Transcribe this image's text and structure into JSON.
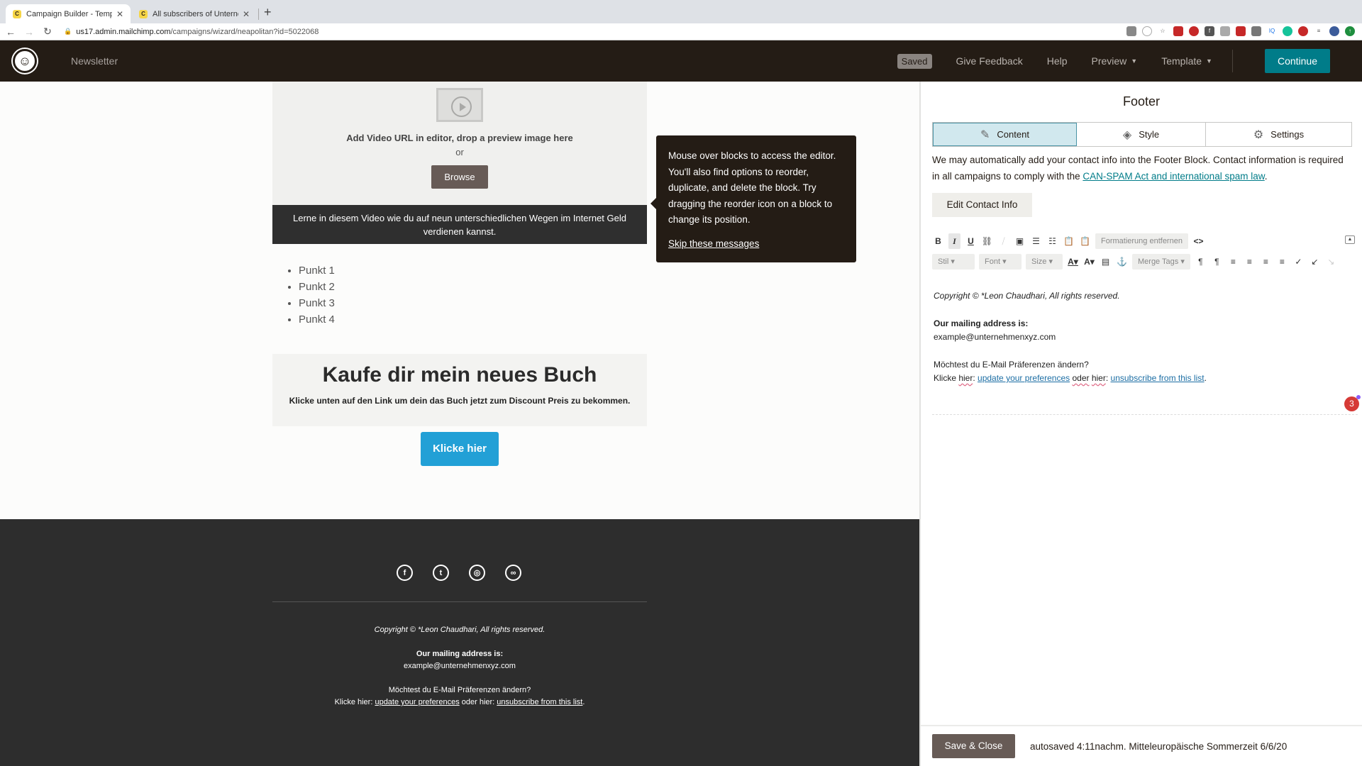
{
  "browser": {
    "tabs": [
      {
        "title": "Campaign Builder - Template D",
        "active": true
      },
      {
        "title": "All subscribers of Unternehmer",
        "active": false
      }
    ],
    "new_tab": "+",
    "url_host": "us17.admin.mailchimp.com",
    "url_path": "/campaigns/wizard/neapolitan?id=5022068"
  },
  "header": {
    "title": "Newsletter",
    "saved_badge": "Saved",
    "nav": [
      "Give Feedback",
      "Help",
      "Preview",
      "Template"
    ],
    "continue_label": "Continue"
  },
  "email": {
    "video": {
      "instruction": "Add Video URL in editor, drop a preview image here",
      "or": "or",
      "browse_label": "Browse",
      "caption": "Lerne in diesem Video wie du auf neun unterschiedlichen Wegen im Internet Geld verdienen kannst."
    },
    "bullets": [
      "Punkt 1",
      "Punkt 2",
      "Punkt 3",
      "Punkt 4"
    ],
    "promo": {
      "heading": "Kaufe dir mein neues Buch",
      "text": "Klicke unten auf den Link um dein das Buch jetzt zum Discount Preis zu bekommen.",
      "button": "Klicke hier"
    },
    "footer": {
      "social": [
        "facebook",
        "twitter",
        "instagram",
        "website"
      ],
      "copyright": "Copyright © *Leon Chaudhari, All rights reserved.",
      "mailing_label": "Our mailing address is:",
      "email": "example@unternehmenxyz.com",
      "prefs_question": "Möchtest du E-Mail Präferenzen ändern?",
      "prefs_prefix": "Klicke hier: ",
      "update_link": "update your preferences",
      "middle": " oder hier: ",
      "unsubscribe_link": "unsubscribe from this list",
      "end": "."
    }
  },
  "tooltip": {
    "text": "Mouse over blocks to access the editor. You'll also find options to reorder, duplicate, and delete the block. Try dragging the reorder icon on a block to change its position.",
    "skip": "Skip these messages"
  },
  "panel": {
    "title": "Footer",
    "tabs": [
      "Content",
      "Style",
      "Settings"
    ],
    "desc_text": "We may automatically add your contact info into the Footer Block. Contact information is required in all campaigns to comply with the ",
    "desc_link": "CAN-SPAM Act and international spam law",
    "desc_end": ".",
    "edit_contact": "Edit Contact Info",
    "toolbar": {
      "remove_format": "Formatierung entfernen",
      "stil": "Stil",
      "font": "Font",
      "size": "Size",
      "merge_tags": "Merge Tags"
    },
    "editor": {
      "copyright": "Copyright © *Leon Chaudhari, All rights reserved.",
      "mailing_label": "Our mailing address is:",
      "email": "example@unternehmenxyz.com",
      "prefs_question": "Möchtest du E-Mail Präferenzen ändern?",
      "klicke": "Klicke ",
      "hier1": "hier",
      "colon1": ": ",
      "update_link": "update your preferences",
      "oder": "oder",
      "hier2": "hier",
      "colon2": ": ",
      "unsubscribe_link": "unsubscribe from this list",
      "end": "."
    },
    "grammarly_count": "3",
    "save_close": "Save & Close",
    "autosave": "autosaved 4:11nachm. Mitteleuropäische Sommerzeit 6/6/20"
  }
}
